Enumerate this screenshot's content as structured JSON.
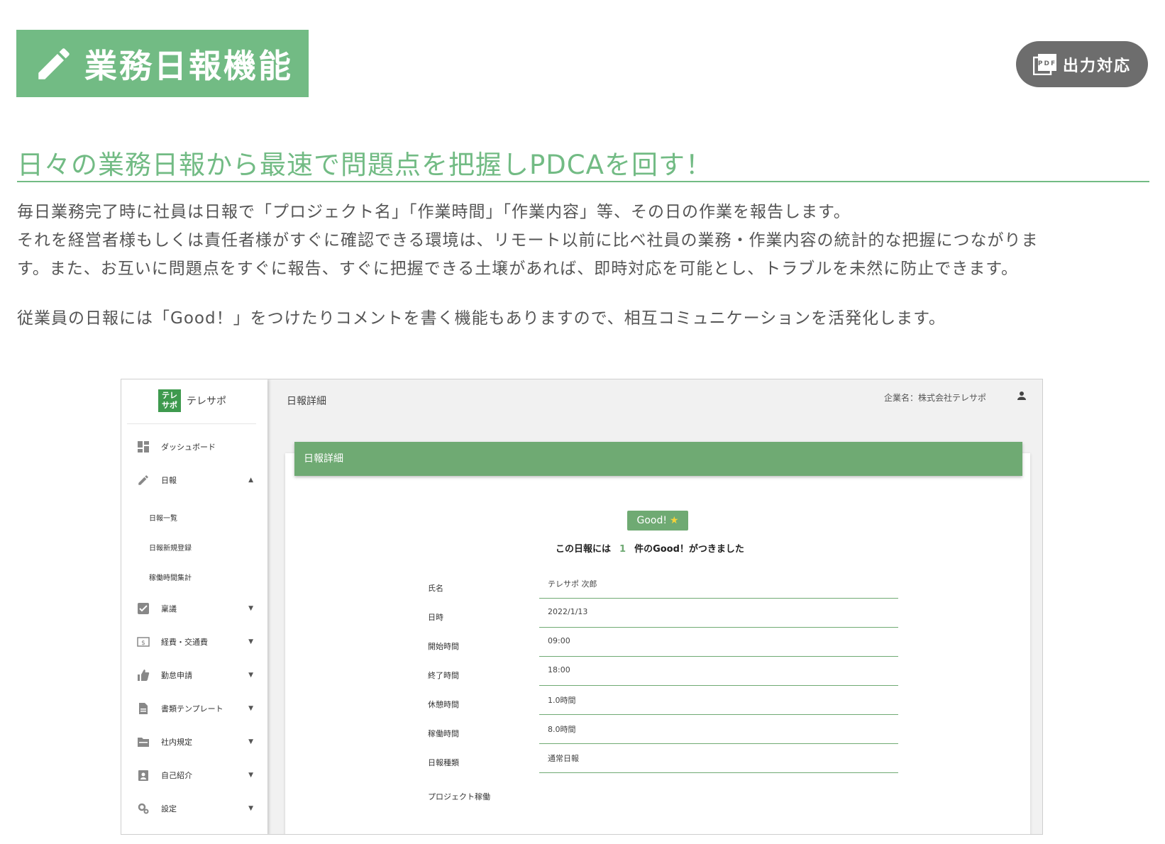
{
  "header": {
    "title": "業務日報機能",
    "badge": "出力対応",
    "badge_icon": "pdf-icon"
  },
  "subtitle": "日々の業務日報から最速で問題点を把握しPDCAを回す！",
  "paragraphs": [
    "毎日業務完了時に社員は日報で「プロジェクト名」「作業時間」「作業内容」等、その日の作業を報告します。",
    "それを経営者様もしくは責任者様がすぐに確認できる環境は、リモート以前に比べ社員の業務・作業内容の統計的な把握につながりま",
    "す。また、お互いに問題点をすぐに報告、すぐに把握できる土壌があれば、即時対応を可能とし、トラブルを未然に防止できます。",
    "従業員の日報には「Good！」をつけたりコメントを書く機能もありますので、相互コミュニケーションを活発化します。"
  ],
  "app": {
    "brand_logo": "テレ\nサポ",
    "brand_name": "テレサポ",
    "topbar_title": "日報詳細",
    "company": "企業名：株式会社テレサポ",
    "sidebar": [
      {
        "label": "ダッシュボード",
        "icon": "dashboard-icon",
        "arrow": ""
      },
      {
        "label": "日報",
        "icon": "pencil-icon",
        "arrow": "▲"
      },
      {
        "label": "稟議",
        "icon": "check-box-icon",
        "arrow": "▼"
      },
      {
        "label": "経費・交通費",
        "icon": "money-icon",
        "arrow": "▼"
      },
      {
        "label": "勤怠申請",
        "icon": "thumb-up-icon",
        "arrow": "▼"
      },
      {
        "label": "書類テンプレート",
        "icon": "document-icon",
        "arrow": "▼"
      },
      {
        "label": "社内規定",
        "icon": "folder-icon",
        "arrow": "▼"
      },
      {
        "label": "自己紹介",
        "icon": "badge-icon",
        "arrow": "▼"
      },
      {
        "label": "設定",
        "icon": "gears-icon",
        "arrow": "▼"
      }
    ],
    "sub_items": [
      "日報一覧",
      "日報新規登録",
      "稼働時間集計"
    ],
    "card_title": "日報詳細",
    "good_label": "Good!",
    "good_prefix": "この日報には",
    "good_count": "1",
    "good_suffix": "件のGood！がつきました",
    "fields": [
      {
        "label": "氏名",
        "value": "テレサポ 次郎"
      },
      {
        "label": "日時",
        "value": "2022/1/13"
      },
      {
        "label": "開始時間",
        "value": "09:00"
      },
      {
        "label": "終了時間",
        "value": "18:00"
      },
      {
        "label": "休憩時間",
        "value": "1.0時間"
      },
      {
        "label": "稼働時間",
        "value": "8.0時間"
      },
      {
        "label": "日報種類",
        "value": "通常日報"
      }
    ],
    "last_label": "プロジェクト稼働"
  },
  "colors": {
    "accent": "#72bb84",
    "card_header": "#6faa73",
    "badge": "#6d6d6d",
    "star": "#f5d33a"
  }
}
